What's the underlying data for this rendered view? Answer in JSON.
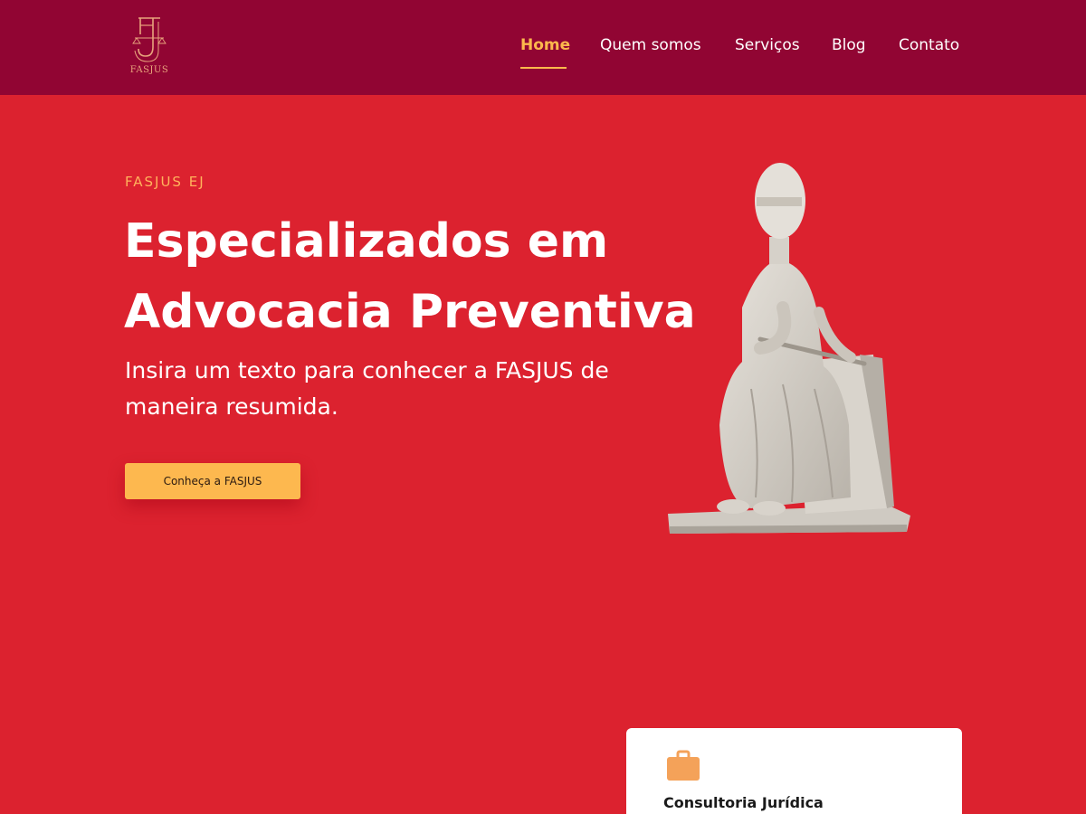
{
  "brand": {
    "logo_text": "FASJUS"
  },
  "nav": {
    "items": [
      {
        "label": "Home"
      },
      {
        "label": "Quem somos"
      },
      {
        "label": "Serviços"
      },
      {
        "label": "Blog"
      },
      {
        "label": "Contato"
      }
    ],
    "active": "Home"
  },
  "hero": {
    "eyebrow": "FASJUS EJ",
    "headline": "Especializados em Advocacia Preventiva",
    "subtitle": "Insira um texto para conhecer a FASJUS de maneira resumida.",
    "cta_label": "Conheça a FASJUS"
  },
  "card": {
    "icon": "briefcase-icon",
    "title": "Consultoria Jurídica"
  },
  "colors": {
    "header_bg": "#910533",
    "hero_bg": "#dc222f",
    "accent": "#fdb94c",
    "eyebrow": "#ffb35c",
    "card_icon": "#f4a259"
  }
}
